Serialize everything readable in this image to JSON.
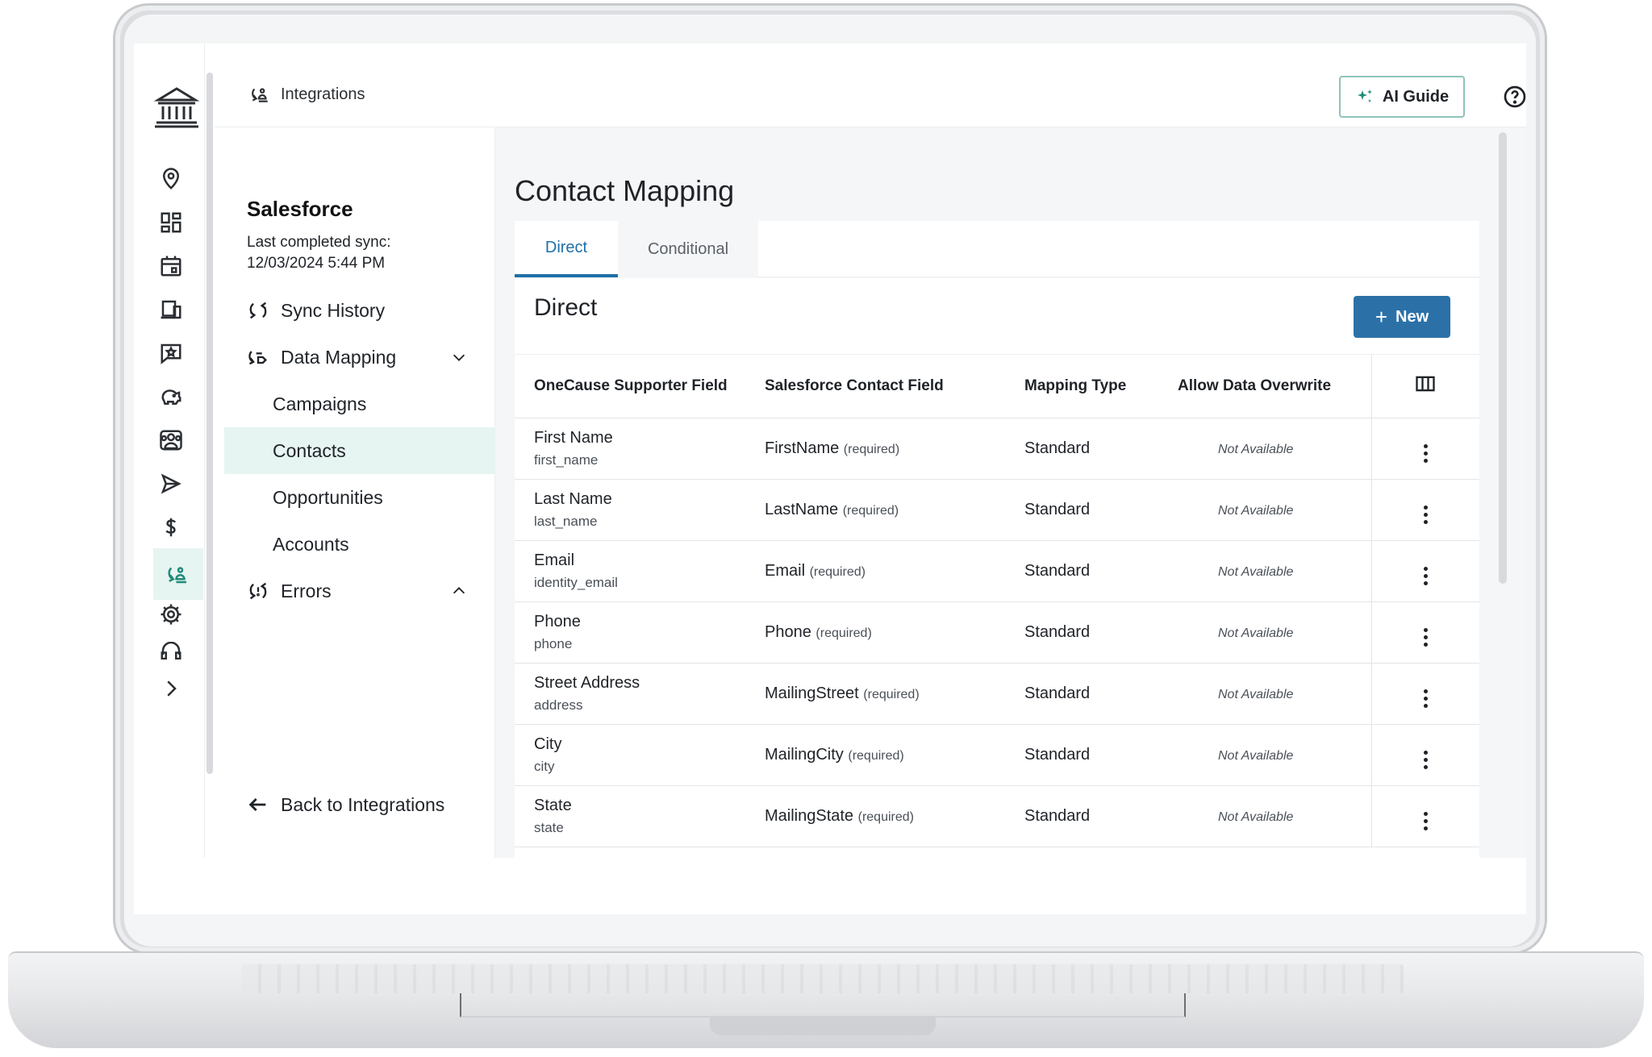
{
  "header": {
    "breadcrumb": "Integrations",
    "ai_guide_label": "AI Guide"
  },
  "sidebar": {
    "integration_name": "Salesforce",
    "last_sync": "Last completed sync: 12/03/2024 5:44 PM",
    "items": [
      {
        "label": "Sync History",
        "icon": "sync-icon"
      },
      {
        "label": "Data Mapping",
        "icon": "data-mapping-icon",
        "expanded": true
      },
      {
        "label": "Campaigns"
      },
      {
        "label": "Contacts",
        "selected": true
      },
      {
        "label": "Opportunities"
      },
      {
        "label": "Accounts"
      },
      {
        "label": "Errors",
        "icon": "sync-error-icon"
      }
    ],
    "back_label": "Back to Integrations"
  },
  "main": {
    "title": "Contact Mapping",
    "tabs": [
      {
        "label": "Direct",
        "active": true
      },
      {
        "label": "Conditional",
        "active": false
      }
    ],
    "section_title": "Direct",
    "new_button_label": "New",
    "new_button_plus": "+",
    "table": {
      "headers": [
        "OneCause Supporter Field",
        "Salesforce Contact Field",
        "Mapping Type",
        "Allow Data Overwrite"
      ],
      "rows": [
        {
          "field": "First Name",
          "key": "first_name",
          "sf_field": "FirstName",
          "req": "(required)",
          "type": "Standard",
          "overwrite": "Not Available"
        },
        {
          "field": "Last Name",
          "key": "last_name",
          "sf_field": "LastName",
          "req": "(required)",
          "type": "Standard",
          "overwrite": "Not Available"
        },
        {
          "field": "Email",
          "key": "identity_email",
          "sf_field": "Email",
          "req": "(required)",
          "type": "Standard",
          "overwrite": "Not Available"
        },
        {
          "field": "Phone",
          "key": "phone",
          "sf_field": "Phone",
          "req": "(required)",
          "type": "Standard",
          "overwrite": "Not Available"
        },
        {
          "field": "Street Address",
          "key": "address",
          "sf_field": "MailingStreet",
          "req": "(required)",
          "type": "Standard",
          "overwrite": "Not Available"
        },
        {
          "field": "City",
          "key": "city",
          "sf_field": "MailingCity",
          "req": "(required)",
          "type": "Standard",
          "overwrite": "Not Available"
        },
        {
          "field": "State",
          "key": "state",
          "sf_field": "MailingState",
          "req": "(required)",
          "type": "Standard",
          "overwrite": "Not Available"
        }
      ]
    }
  },
  "colors": {
    "accent_teal": "#1f8a78",
    "primary_blue": "#2b71a8",
    "selected_bg": "#e6f4f2"
  }
}
